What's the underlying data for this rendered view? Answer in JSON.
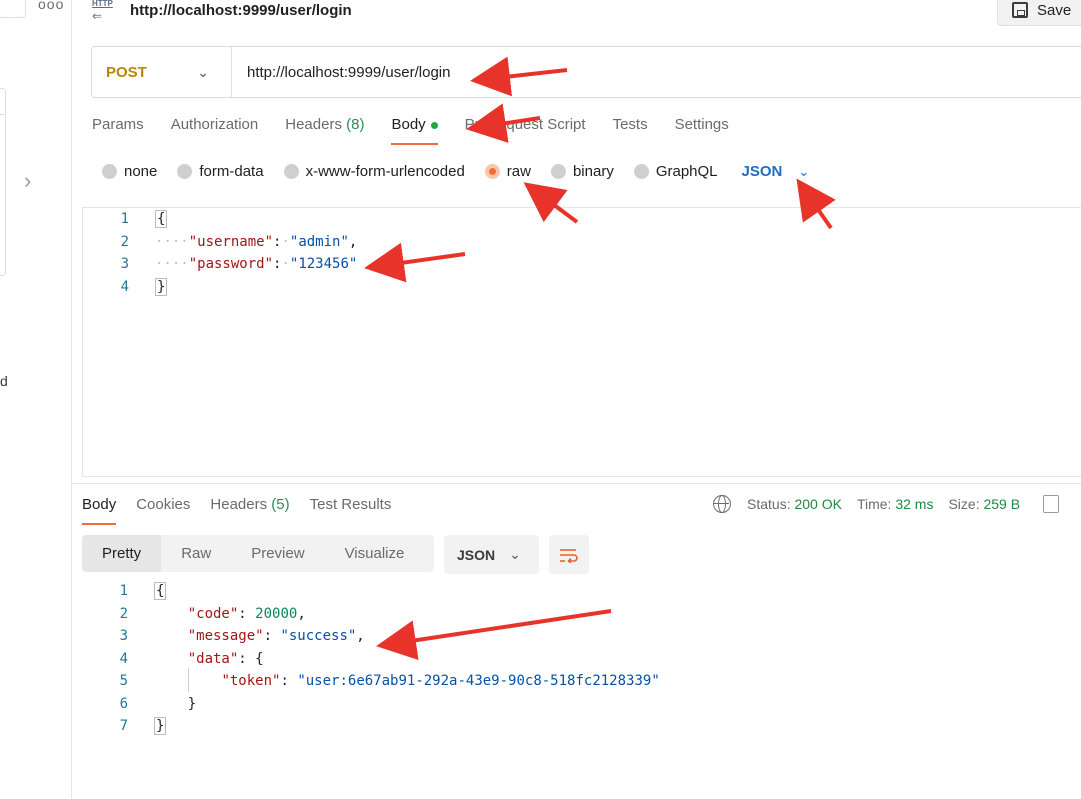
{
  "window": {
    "title": "http://localhost:9999/user/login",
    "save_label": "Save",
    "icon_text": "HTTP",
    "left_truncated_text": "d"
  },
  "request": {
    "method": "POST",
    "url": "http://localhost:9999/user/login",
    "tabs": [
      {
        "label": "Params"
      },
      {
        "label": "Authorization"
      },
      {
        "label": "Headers",
        "count": "(8)"
      },
      {
        "label": "Body",
        "active": true
      },
      {
        "label": "Pre-request Script"
      },
      {
        "label": "Tests"
      },
      {
        "label": "Settings"
      }
    ],
    "body_types": [
      "none",
      "form-data",
      "x-www-form-urlencoded",
      "raw",
      "binary",
      "GraphQL"
    ],
    "selected_body_type": "raw",
    "body_format": "JSON",
    "body_lines": [
      "1",
      "2",
      "3",
      "4"
    ],
    "body": {
      "username_key": "\"username\"",
      "username_val": "\"admin\"",
      "password_key": "\"password\"",
      "password_val": "\"123456\""
    }
  },
  "response": {
    "tabs": [
      {
        "label": "Body",
        "active": true
      },
      {
        "label": "Cookies"
      },
      {
        "label": "Headers",
        "count": "(5)"
      },
      {
        "label": "Test Results"
      }
    ],
    "status_label": "Status:",
    "status_value": "200 OK",
    "time_label": "Time:",
    "time_value": "32 ms",
    "size_label": "Size:",
    "size_value": "259 B",
    "view_tabs": [
      "Pretty",
      "Raw",
      "Preview",
      "Visualize"
    ],
    "format": "JSON",
    "lines": [
      "1",
      "2",
      "3",
      "4",
      "5",
      "6",
      "7"
    ],
    "body": {
      "code_key": "\"code\"",
      "code_val": "20000",
      "message_key": "\"message\"",
      "message_val": "\"success\"",
      "data_key": "\"data\"",
      "token_key": "\"token\"",
      "token_val": "\"user:6e67ab91-292a-43e9-90c8-518fc2128339\""
    }
  },
  "colors": {
    "accent": "#f26b3a",
    "method": "#b8860b",
    "status_ok": "#1a8a3f",
    "json_select": "#1f6fbf",
    "annotation_arrow": "#e8332a"
  }
}
